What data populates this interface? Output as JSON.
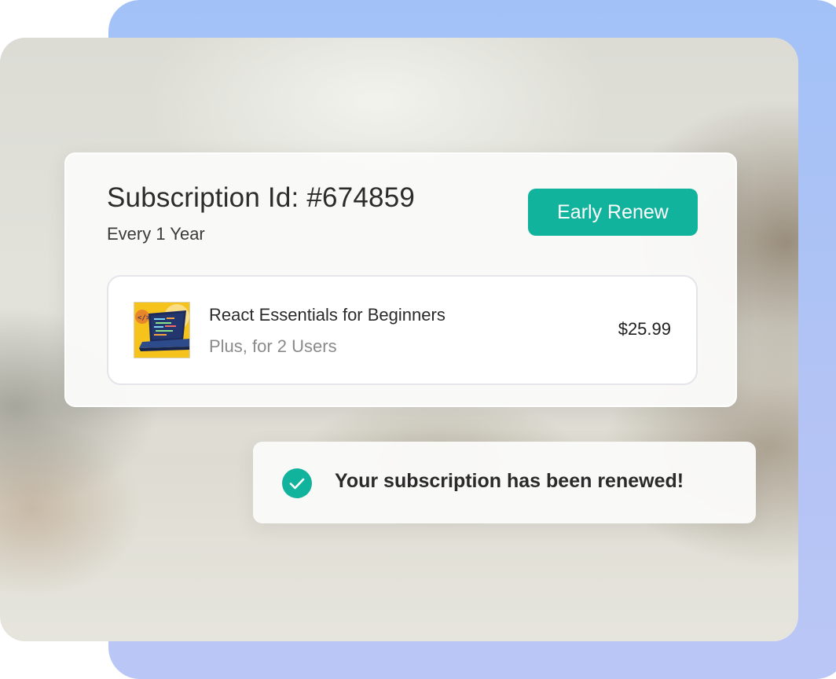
{
  "subscription": {
    "title": "Subscription Id: #674859",
    "frequency": "Every 1 Year",
    "renew_button_label": "Early Renew"
  },
  "product": {
    "thumbnail_icon": "laptop-code-icon",
    "name": "React Essentials for Beginners",
    "plan": "Plus, for 2 Users",
    "price": "$25.99"
  },
  "toast": {
    "icon": "check-circle-icon",
    "message": "Your subscription has been renewed!"
  },
  "colors": {
    "accent": "#12b39c",
    "back_panel": "#a2c2f7"
  }
}
